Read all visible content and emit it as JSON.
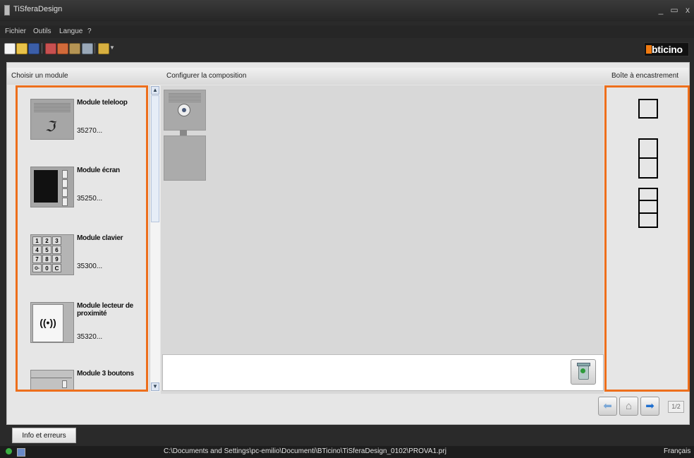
{
  "window": {
    "title": "TiSferaDesign",
    "minimize": "_",
    "maximize": "▭",
    "close": "x"
  },
  "menu": [
    "Fichier",
    "Outils",
    "Langue",
    "?"
  ],
  "toolbar": {
    "icons": [
      "new-file-icon",
      "open-folder-icon",
      "save-icon",
      "import-icon",
      "export-icon",
      "tools-icon",
      "print-icon",
      "language-icon"
    ]
  },
  "logo": {
    "text": "bticino"
  },
  "columns": {
    "left": "Choisir un module",
    "center": "Configurer la composition",
    "right": "Boîte à encastrement"
  },
  "modules": [
    {
      "name": "Module teleloop",
      "code": "35270..."
    },
    {
      "name": "Module écran",
      "code": "35250..."
    },
    {
      "name": "Module clavier",
      "code": "35300..."
    },
    {
      "name": "Module lecteur de proximité",
      "code": "35320..."
    },
    {
      "name": "Module 3 boutons",
      "code": ""
    }
  ],
  "keypad": [
    "1",
    "2",
    "3",
    "4",
    "5",
    "6",
    "7",
    "8",
    "9",
    "O-",
    "0",
    "C"
  ],
  "navigation": {
    "page": "1/2"
  },
  "bottom": {
    "info_button": "Info et erreurs"
  },
  "status": {
    "path": "C:\\Documents and Settings\\pc-emilio\\Documenti\\BTicino\\TiSferaDesign_0102\\PROVA1.prj",
    "language": "Français"
  },
  "colors": {
    "highlight": "#ed6f1c",
    "brand": "#f07a10"
  }
}
